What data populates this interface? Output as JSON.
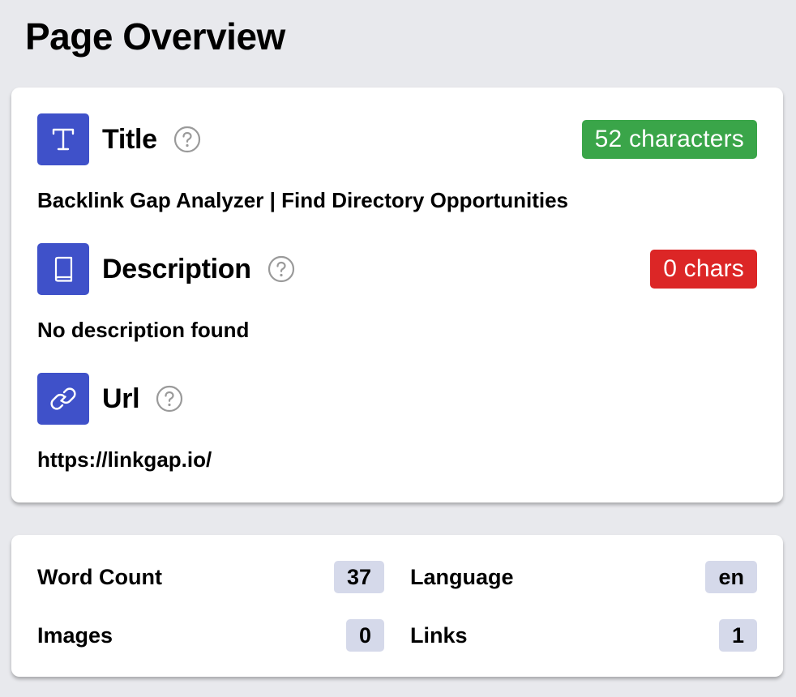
{
  "page_title": "Page Overview",
  "colors": {
    "icon_bg": "#3f51c9",
    "badge_good": "#3aa549",
    "badge_bad": "#dc2626",
    "stat_chip_bg": "#d5d9ea",
    "page_bg": "#e8e9ed"
  },
  "sections": {
    "title": {
      "label": "Title",
      "icon": "text-t-icon",
      "badge": "52 characters",
      "value": "Backlink Gap Analyzer | Find Directory Opportunities"
    },
    "description": {
      "label": "Description",
      "icon": "book-icon",
      "badge": "0 chars",
      "value": "No description found"
    },
    "url": {
      "label": "Url",
      "icon": "link-icon",
      "value": "https://linkgap.io/"
    }
  },
  "stats": {
    "word_count": {
      "label": "Word Count",
      "value": "37"
    },
    "language": {
      "label": "Language",
      "value": "en"
    },
    "images": {
      "label": "Images",
      "value": "0"
    },
    "links": {
      "label": "Links",
      "value": "1"
    }
  }
}
